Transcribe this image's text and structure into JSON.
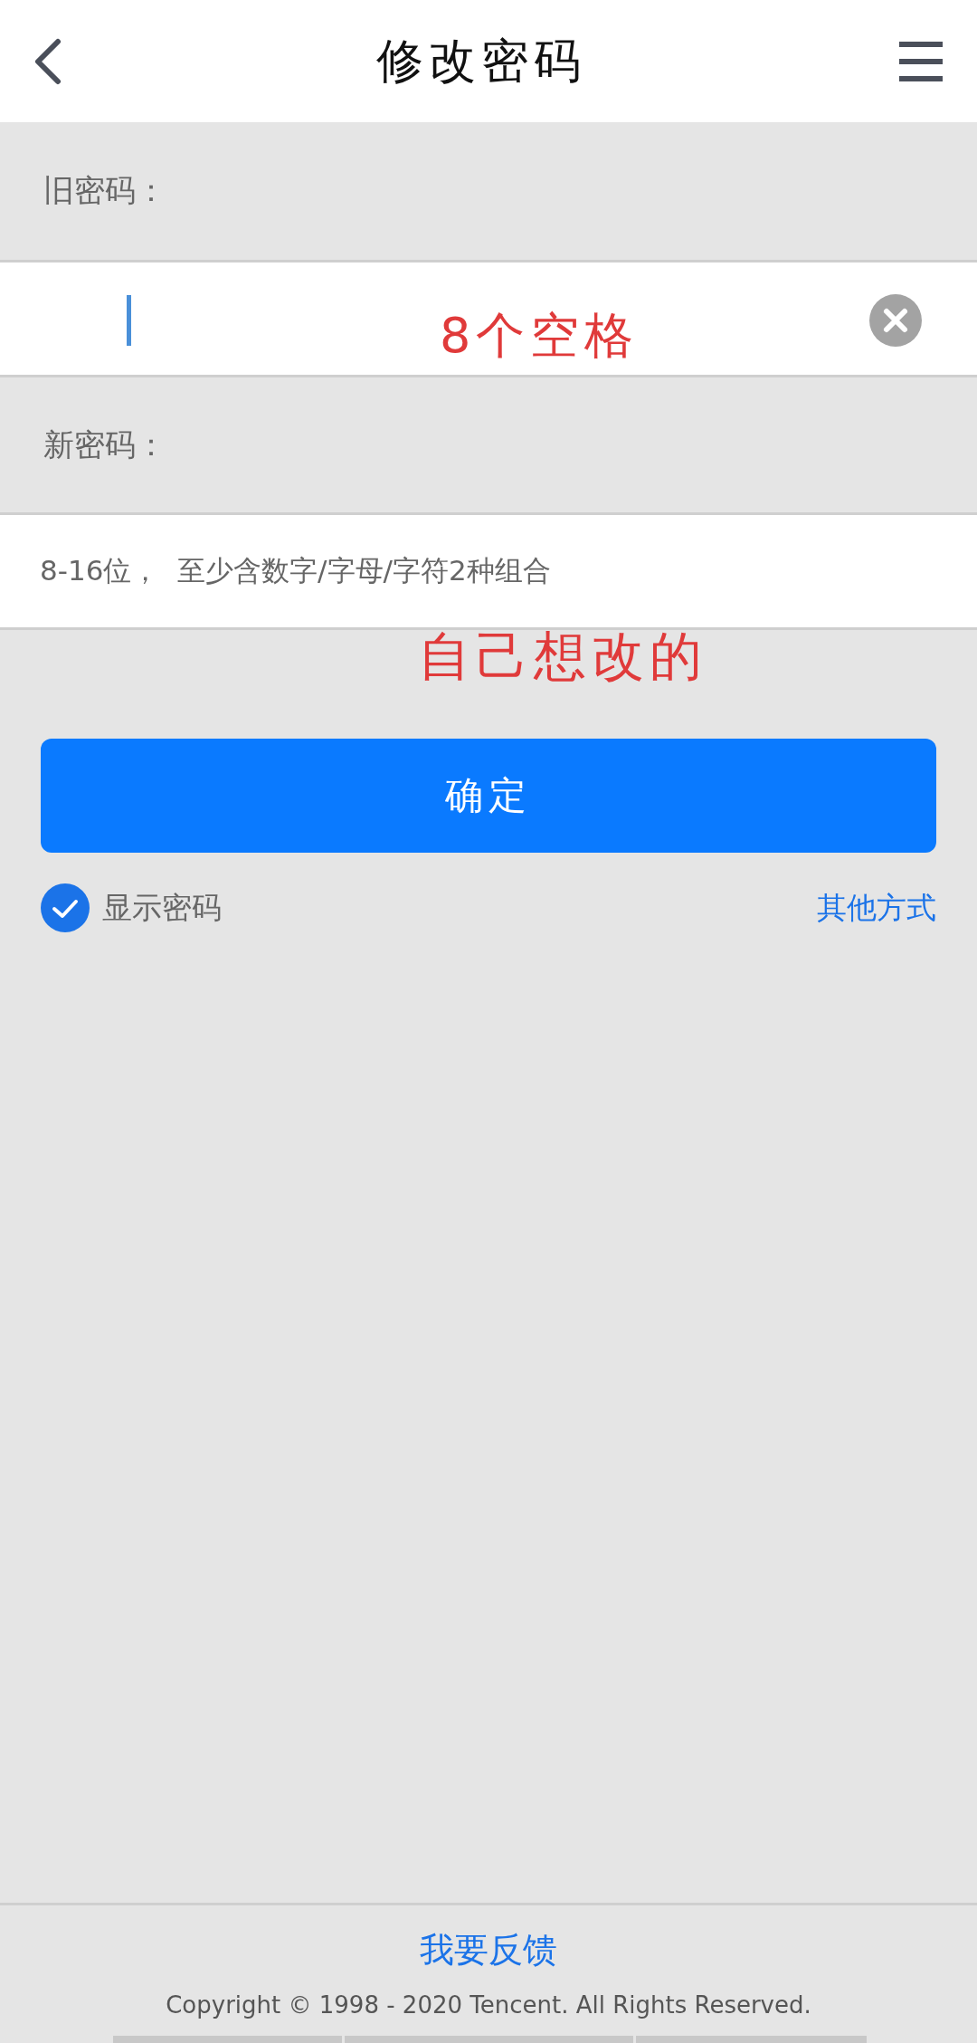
{
  "header": {
    "title": "修改密码"
  },
  "fields": [
    {
      "label": "旧密码：",
      "focused": true,
      "clear_button": true,
      "annotation": "8个空格"
    },
    {
      "label": "新密码：",
      "placeholder": "8-16位，  至少含数字/字母/字符2种组合",
      "focused": false,
      "clear_button": false,
      "annotation": "自己想改的"
    }
  ],
  "submit": {
    "label": "确定"
  },
  "show_password": {
    "label": "显示密码",
    "checked": true
  },
  "other_link": "其他方式",
  "footer": {
    "feedback": "我要反馈",
    "copyright": "Copyright © 1998 - 2020 Tencent. All Rights Reserved."
  }
}
